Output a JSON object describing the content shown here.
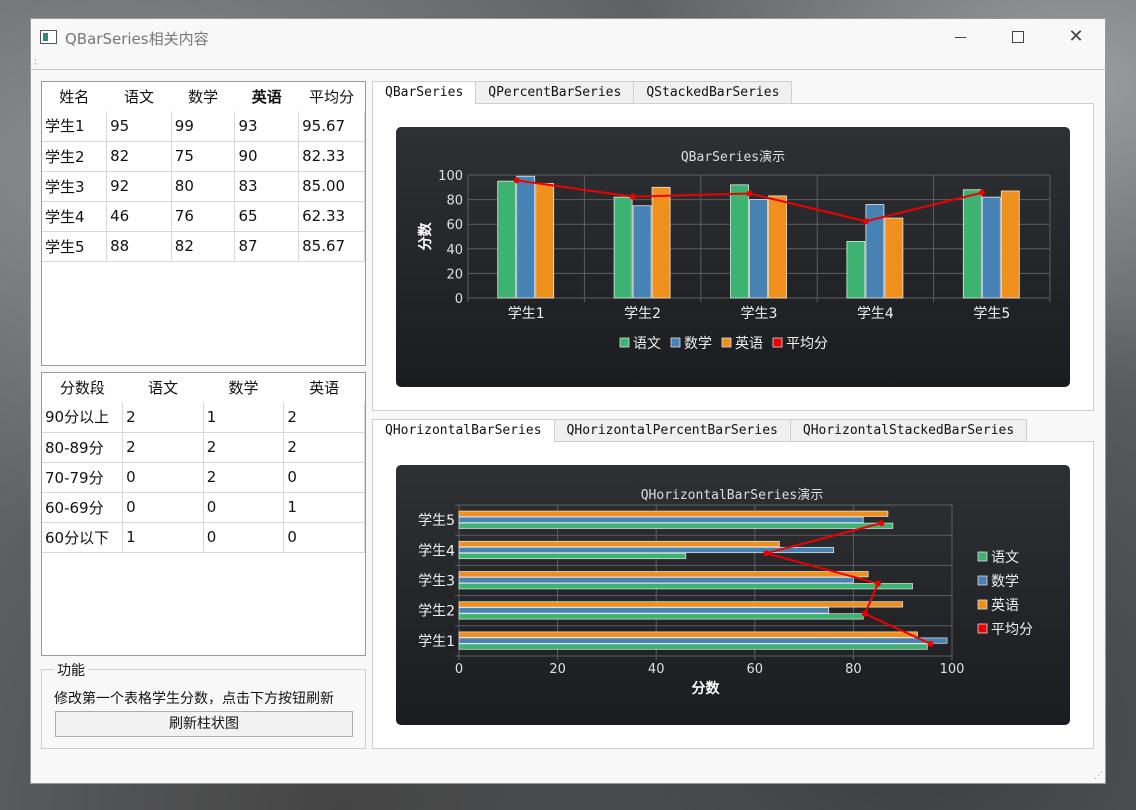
{
  "window": {
    "title": "QBarSeries相关内容"
  },
  "icons": [
    "minimize-icon",
    "maximize-icon",
    "close-icon"
  ],
  "score_table": {
    "headers": [
      "姓名",
      "语文",
      "数学",
      "英语",
      "平均分"
    ],
    "rows": [
      [
        "学生1",
        "95",
        "99",
        "93",
        "95.67"
      ],
      [
        "学生2",
        "82",
        "75",
        "90",
        "82.33"
      ],
      [
        "学生3",
        "92",
        "80",
        "83",
        "85.00"
      ],
      [
        "学生4",
        "46",
        "76",
        "65",
        "62.33"
      ],
      [
        "学生5",
        "88",
        "82",
        "87",
        "85.67"
      ]
    ]
  },
  "range_table": {
    "headers": [
      "分数段",
      "语文",
      "数学",
      "英语"
    ],
    "rows": [
      [
        "90分以上",
        "2",
        "1",
        "2"
      ],
      [
        "80-89分",
        "2",
        "2",
        "2"
      ],
      [
        "70-79分",
        "0",
        "2",
        "0"
      ],
      [
        "60-69分",
        "0",
        "0",
        "1"
      ],
      [
        "60分以下",
        "1",
        "0",
        "0"
      ]
    ]
  },
  "function_group": {
    "title": "功能",
    "description": "修改第一个表格学生分数，点击下方按钮刷新",
    "refresh_button": "刷新柱状图"
  },
  "top_tabs": [
    "QBarSeries",
    "QPercentBarSeries",
    "QStackedBarSeries"
  ],
  "bottom_tabs": [
    "QHorizontalBarSeries",
    "QHorizontalPercentBarSeries",
    "QHorizontalStackedBarSeries"
  ],
  "colors": {
    "chinese": "#3cb371",
    "math": "#4682b4",
    "english": "#f0901c",
    "average": "#ee0000",
    "chart_bg": "#26282c"
  },
  "chart_data": [
    {
      "type": "bar",
      "title": "QBarSeries演示",
      "categories": [
        "学生1",
        "学生2",
        "学生3",
        "学生4",
        "学生5"
      ],
      "series": [
        {
          "name": "语文",
          "values": [
            95,
            82,
            92,
            46,
            88
          ]
        },
        {
          "name": "数学",
          "values": [
            99,
            75,
            80,
            76,
            82
          ]
        },
        {
          "name": "英语",
          "values": [
            93,
            90,
            83,
            65,
            87
          ]
        }
      ],
      "line_series": {
        "name": "平均分",
        "values": [
          95.67,
          82.33,
          85.0,
          62.33,
          85.67
        ]
      },
      "ylabel": "分数",
      "ylim": [
        0,
        100
      ],
      "yticks": [
        0,
        20,
        40,
        60,
        80,
        100
      ],
      "grid": true,
      "legend": "bottom"
    },
    {
      "type": "bar",
      "orientation": "horizontal",
      "title": "QHorizontalBarSeries演示",
      "categories": [
        "学生1",
        "学生2",
        "学生3",
        "学生4",
        "学生5"
      ],
      "series": [
        {
          "name": "语文",
          "values": [
            95,
            82,
            92,
            46,
            88
          ]
        },
        {
          "name": "数学",
          "values": [
            99,
            75,
            80,
            76,
            82
          ]
        },
        {
          "name": "英语",
          "values": [
            93,
            90,
            83,
            65,
            87
          ]
        }
      ],
      "line_series": {
        "name": "平均分",
        "values": [
          95.67,
          82.33,
          85.0,
          62.33,
          85.67
        ]
      },
      "xlabel": "分数",
      "xlim": [
        0,
        100
      ],
      "xticks": [
        0,
        20,
        40,
        60,
        80,
        100
      ],
      "grid": true,
      "legend": "right"
    }
  ]
}
